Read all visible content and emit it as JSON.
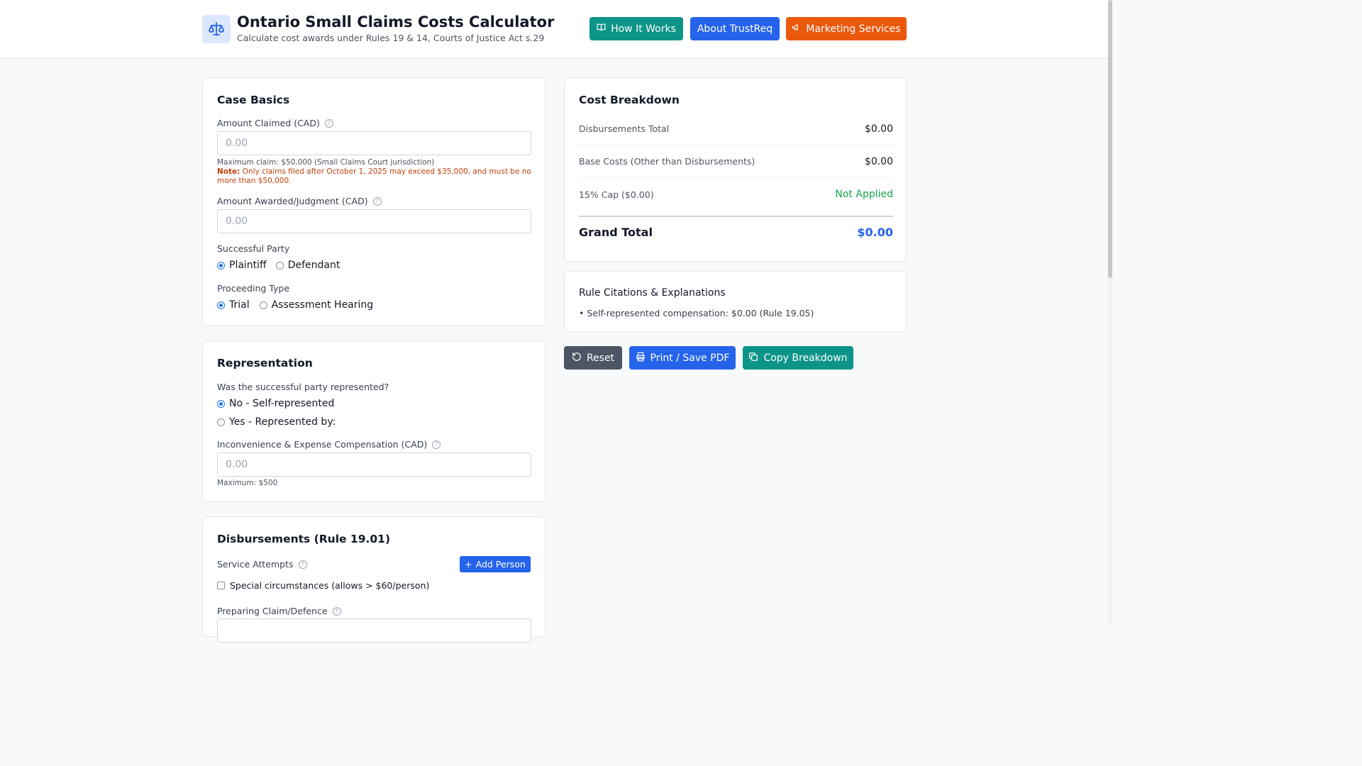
{
  "header": {
    "title": "Ontario Small Claims Costs Calculator",
    "subtitle": "Calculate cost awards under Rules 19 & 14, Courts of Justice Act s.29",
    "logo_icon": "scale-icon",
    "buttons": {
      "how_it_works": "How It Works",
      "about": "About TrustReq",
      "marketing": "Marketing Services"
    }
  },
  "case_basics": {
    "title": "Case Basics",
    "amount_claimed_label": "Amount Claimed (CAD)",
    "amount_claimed_placeholder": "0.00",
    "max_claim_hint": "Maximum claim: $50,000 (Small Claims Court jurisdiction)",
    "note_prefix": "Note:",
    "note_text": " Only claims filed after October 1, 2025 may exceed $35,000, and must be no more than $50,000.",
    "amount_awarded_label": "Amount Awarded/Judgment (CAD)",
    "amount_awarded_placeholder": "0.00",
    "successful_party_label": "Successful Party",
    "party_plaintiff": "Plaintiff",
    "party_defendant": "Defendant",
    "party_selected": "Plaintiff",
    "proceeding_type_label": "Proceeding Type",
    "proceeding_trial": "Trial",
    "proceeding_assessment": "Assessment Hearing",
    "proceeding_selected": "Trial"
  },
  "representation": {
    "title": "Representation",
    "question": "Was the successful party represented?",
    "option_no": "No - Self-represented",
    "option_yes": "Yes - Represented by:",
    "selected": "No - Self-represented",
    "comp_label": "Inconvenience & Expense Compensation (CAD)",
    "comp_placeholder": "0.00",
    "comp_hint": "Maximum: $500"
  },
  "disbursements": {
    "title": "Disbursements (Rule 19.01)",
    "service_label": "Service Attempts",
    "add_person": "Add Person",
    "special_label": "Special circumstances (allows > $60/person)",
    "special_checked": false,
    "preparing_label": "Preparing Claim/Defence"
  },
  "cost_breakdown": {
    "title": "Cost Breakdown",
    "rows": [
      {
        "label": "Disbursements Total",
        "value": "$0.00"
      },
      {
        "label": "Base Costs (Other than Disbursements)",
        "value": "$0.00"
      },
      {
        "label": "15% Cap ($0.00)",
        "value": "Not Applied"
      }
    ],
    "grand_total_label": "Grand Total",
    "grand_total_value": "$0.00",
    "status_color": "#16a34a",
    "total_color": "#2563eb"
  },
  "citations": {
    "title": "Rule Citations & Explanations",
    "items": [
      "• Self-represented compensation: $0.00 (Rule 19.05)"
    ]
  },
  "actions": {
    "reset": "Reset",
    "print": "Print / Save PDF",
    "copy": "Copy Breakdown"
  }
}
